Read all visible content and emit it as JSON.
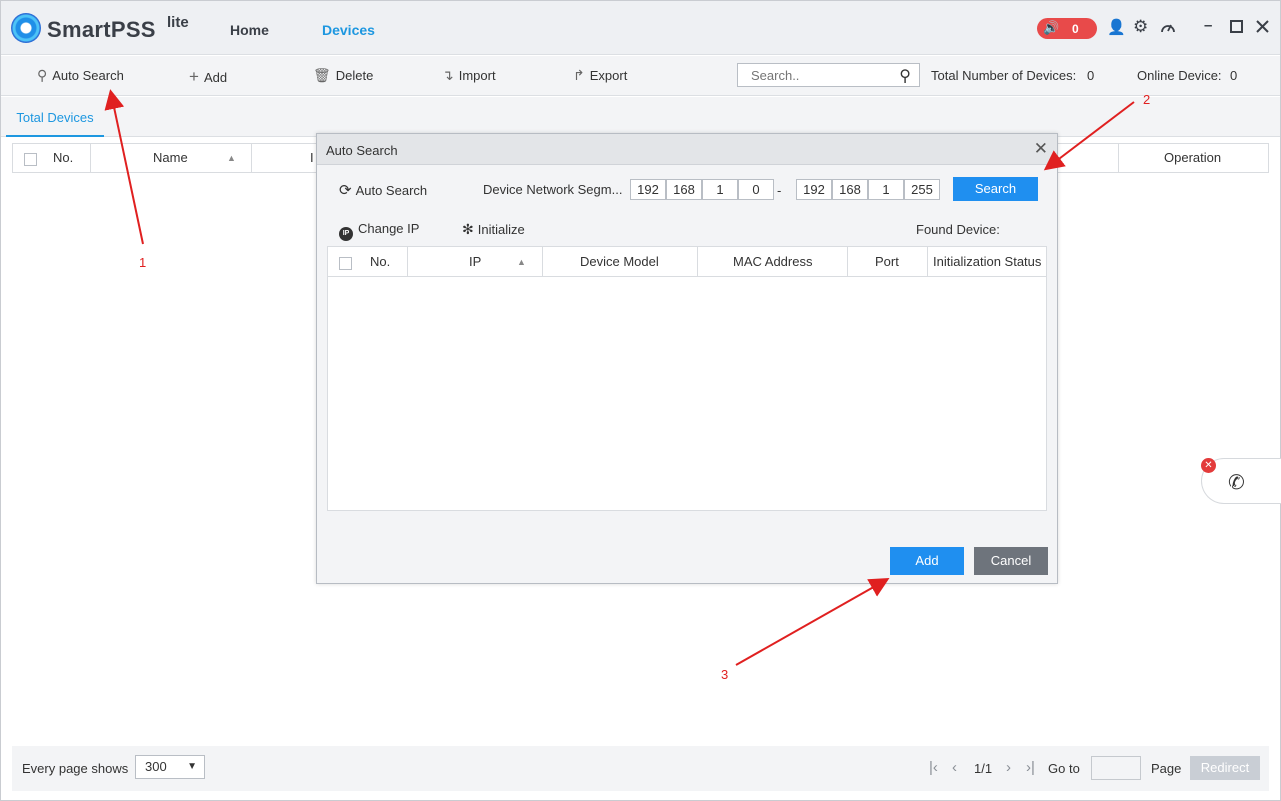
{
  "app": {
    "brand": "SmartPSS",
    "brand_sup": "lite",
    "nav": {
      "home": "Home",
      "devices": "Devices"
    },
    "alarm_count": "0",
    "window_icons": [
      "user-icon",
      "gear-icon",
      "speedometer-icon",
      "minimize-icon",
      "maximize-icon",
      "close-icon"
    ]
  },
  "toolbar": {
    "auto_search": "Auto Search",
    "add": "Add",
    "delete": "Delete",
    "import": "Import",
    "export": "Export",
    "search_placeholder": "Search..",
    "total_label": "Total Number of Devices:",
    "total_value": "0",
    "online_label": "Online Device:",
    "online_value": "0"
  },
  "tabs": {
    "total_devices": "Total Devices"
  },
  "main_table": {
    "columns": {
      "no": "No.",
      "name": "Name",
      "ip_partial": "I",
      "operation": "Operation"
    }
  },
  "dialog": {
    "title": "Auto Search",
    "auto_search": "Auto Search",
    "segment_label": "Device Network Segm...",
    "start_ip": [
      "192",
      "168",
      "1",
      "0"
    ],
    "dash": "-",
    "end_ip": [
      "192",
      "168",
      "1",
      "255"
    ],
    "search_button": "Search",
    "change_ip": "Change IP",
    "initialize": "Initialize",
    "found_label": "Found Device:",
    "columns": {
      "no": "No.",
      "ip": "IP",
      "model": "Device Model",
      "mac": "MAC Address",
      "port": "Port",
      "init_status": "Initialization Status"
    },
    "add_button": "Add",
    "cancel_button": "Cancel"
  },
  "footer": {
    "every_page": "Every page shows",
    "page_size": "300",
    "page_indicator": "1/1",
    "goto": "Go to",
    "page": "Page",
    "redirect": "Redirect"
  },
  "annotations": {
    "a1": "1",
    "a2": "2",
    "a3": "3"
  },
  "colors": {
    "accent": "#1d97e0",
    "alarm": "#e84a4a",
    "annotation": "#e02020"
  }
}
